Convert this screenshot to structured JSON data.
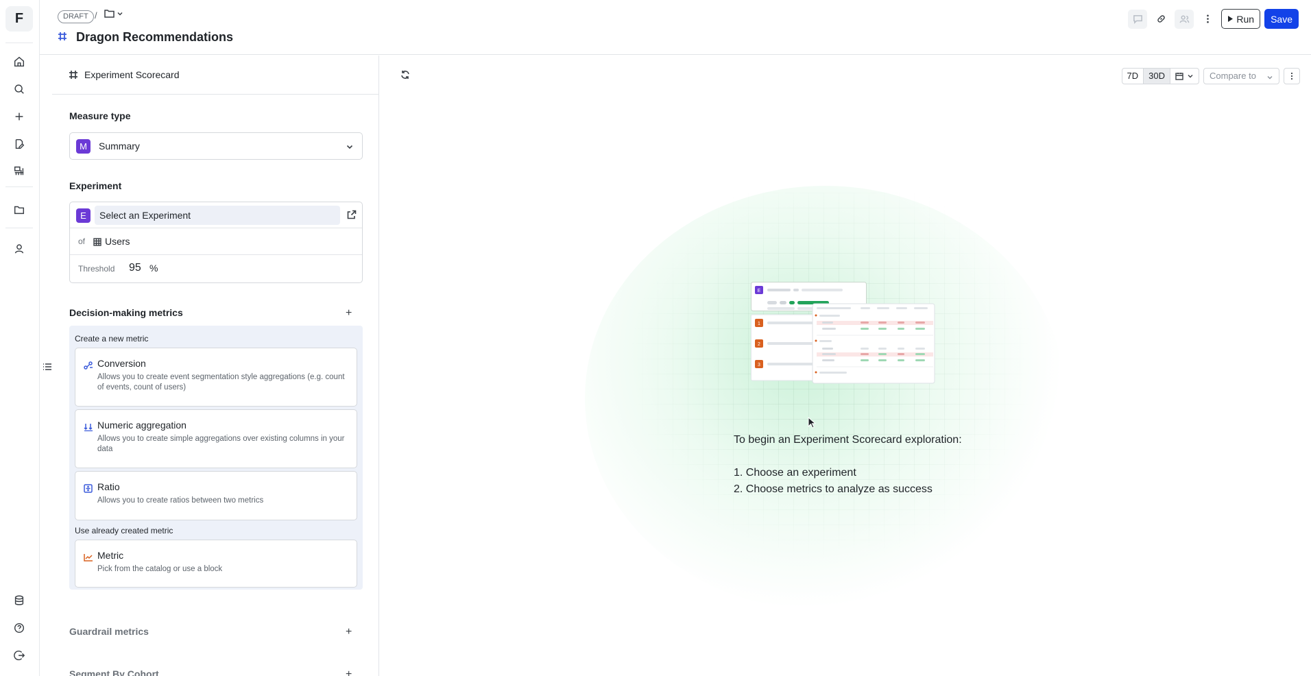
{
  "rail": {
    "logo": "F",
    "icons": [
      "home-icon",
      "search-icon",
      "plus-icon",
      "edit-document-icon",
      "chart-board-icon",
      "folder-icon",
      "person-icon",
      "database-icon",
      "help-icon",
      "logout-icon"
    ]
  },
  "header": {
    "draft_badge": "DRAFT",
    "separator": "/",
    "title": "Dragon Recommendations",
    "run_label": "Run",
    "save_label": "Save"
  },
  "panel": {
    "title": "Experiment Scorecard",
    "measure_type": {
      "label": "Measure type",
      "badge": "M",
      "value": "Summary"
    },
    "experiment": {
      "label": "Experiment",
      "badge": "E",
      "placeholder": "Select an Experiment",
      "of_label": "of",
      "table_name": "Users",
      "threshold_label": "Threshold",
      "threshold_value": "95",
      "threshold_unit": "%"
    },
    "decision_metrics": {
      "label": "Decision-making metrics",
      "create_label": "Create a new metric",
      "cards": [
        {
          "title": "Conversion",
          "desc": "Allows you to create event segmentation style aggregations (e.g. count of events, count of users)"
        },
        {
          "title": "Numeric aggregation",
          "desc": "Allows you to create simple aggregations over existing columns in your data"
        },
        {
          "title": "Ratio",
          "desc": "Allows you to create ratios between two metrics"
        }
      ],
      "existing_label": "Use already created metric",
      "existing_card": {
        "title": "Metric",
        "desc": "Pick from the catalog or use a block"
      }
    },
    "guardrail_label": "Guardrail metrics",
    "segment_label": "Segment By Cohort"
  },
  "main": {
    "range_7d": "7D",
    "range_30d": "30D",
    "compare_label": "Compare to",
    "empty_title": "To begin an Experiment Scorecard exploration:",
    "steps": [
      "1. Choose an experiment",
      "2. Choose metrics to analyze as success"
    ],
    "illustration_badges": [
      "E",
      "1",
      "2",
      "3"
    ]
  },
  "colors": {
    "accent": "#1342e8",
    "badge_purple": "#6b3ad6",
    "badge_orange": "#d9601f",
    "success_green": "#22a35a"
  }
}
